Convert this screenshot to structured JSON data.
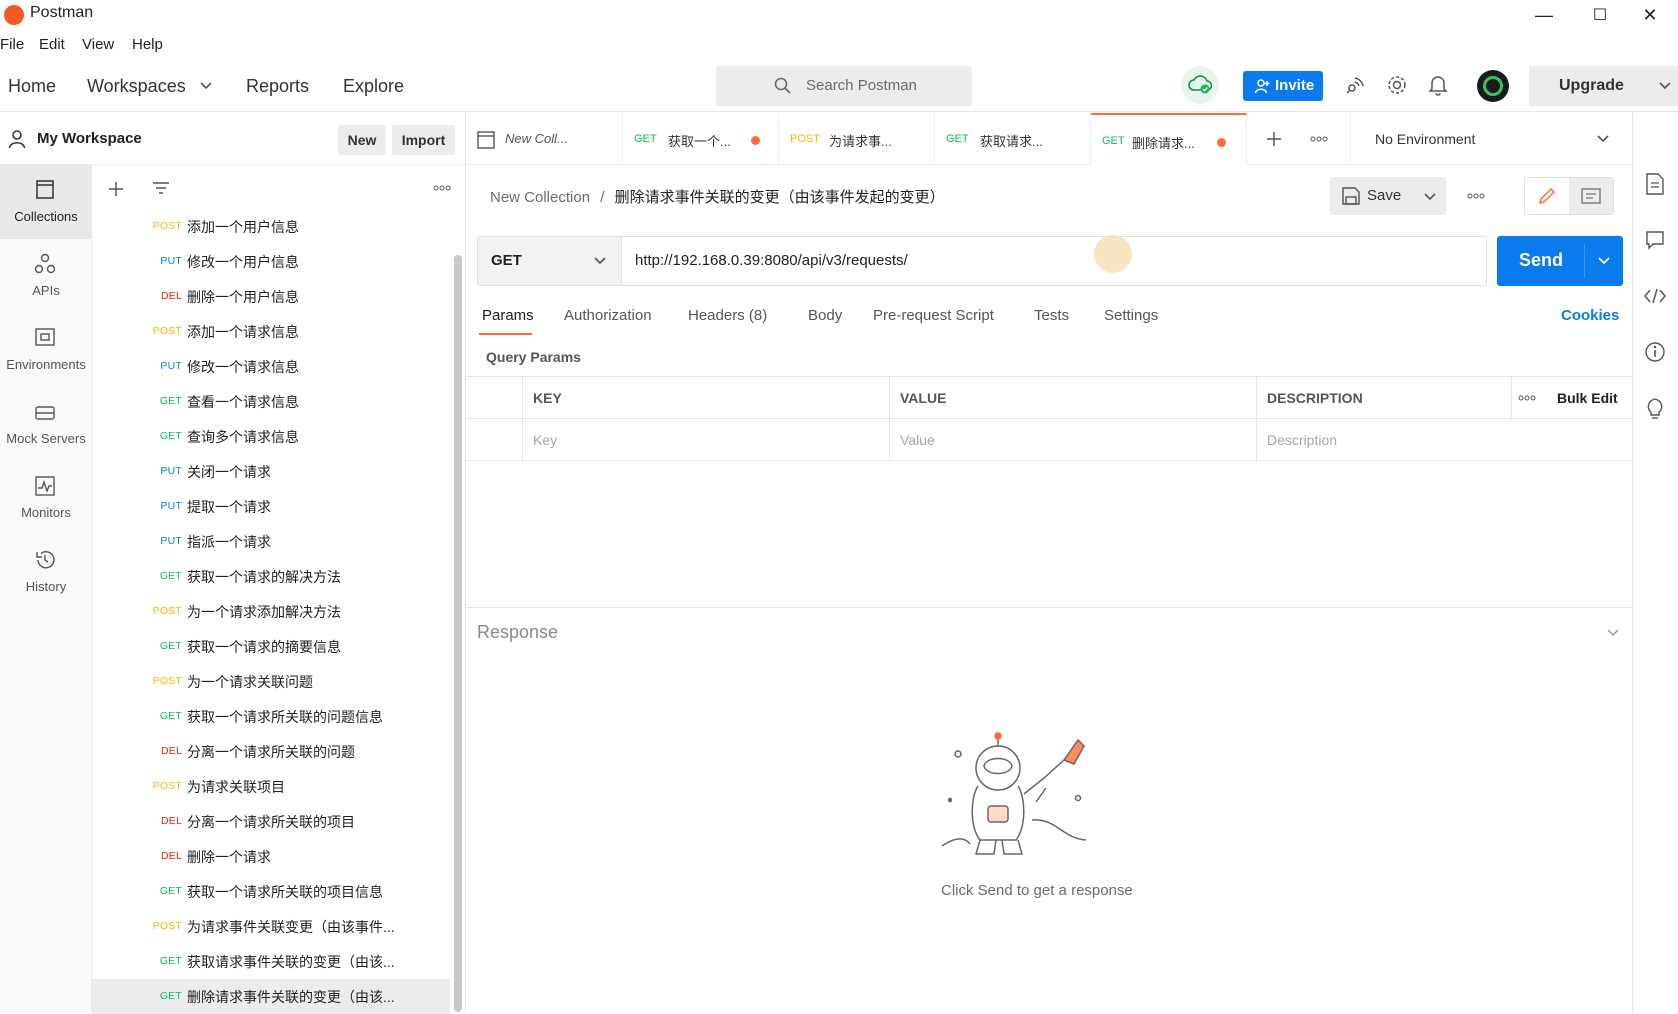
{
  "window": {
    "title": "Postman",
    "min": "—",
    "max": "☐",
    "close": "✕"
  },
  "menu": [
    "File",
    "Edit",
    "View",
    "Help"
  ],
  "nav": {
    "home": "Home",
    "workspaces": "Workspaces",
    "reports": "Reports",
    "explore": "Explore"
  },
  "search": {
    "placeholder": "Search Postman"
  },
  "invite": "Invite",
  "upgrade": "Upgrade",
  "workspace": {
    "name": "My Workspace",
    "new": "New",
    "import": "Import"
  },
  "leftnav": [
    "Collections",
    "APIs",
    "Environments",
    "Mock Servers",
    "Monitors",
    "History"
  ],
  "requests": [
    {
      "method": "POST",
      "name": "添加一个用户信息"
    },
    {
      "method": "PUT",
      "name": "修改一个用户信息"
    },
    {
      "method": "DEL",
      "name": "删除一个用户信息"
    },
    {
      "method": "POST",
      "name": "添加一个请求信息"
    },
    {
      "method": "PUT",
      "name": "修改一个请求信息"
    },
    {
      "method": "GET",
      "name": "查看一个请求信息"
    },
    {
      "method": "GET",
      "name": "查询多个请求信息"
    },
    {
      "method": "PUT",
      "name": "关闭一个请求"
    },
    {
      "method": "PUT",
      "name": "提取一个请求"
    },
    {
      "method": "PUT",
      "name": "指派一个请求"
    },
    {
      "method": "GET",
      "name": "获取一个请求的解决方法"
    },
    {
      "method": "POST",
      "name": "为一个请求添加解决方法"
    },
    {
      "method": "GET",
      "name": "获取一个请求的摘要信息"
    },
    {
      "method": "POST",
      "name": "为一个请求关联问题"
    },
    {
      "method": "GET",
      "name": "获取一个请求所关联的问题信息"
    },
    {
      "method": "DEL",
      "name": "分离一个请求所关联的问题"
    },
    {
      "method": "POST",
      "name": "为请求关联项目"
    },
    {
      "method": "DEL",
      "name": "分离一个请求所关联的项目"
    },
    {
      "method": "DEL",
      "name": "删除一个请求"
    },
    {
      "method": "GET",
      "name": "获取一个请求所关联的项目信息"
    },
    {
      "method": "POST",
      "name": "为请求事件关联变更（由该事件..."
    },
    {
      "method": "GET",
      "name": "获取请求事件关联的变更（由该..."
    },
    {
      "method": "GET",
      "name": "删除请求事件关联的变更（由该..."
    }
  ],
  "tabs": [
    {
      "method": "",
      "title": "New Coll..."
    },
    {
      "method": "GET",
      "title": "获取一个..."
    },
    {
      "method": "POST",
      "title": "为请求事..."
    },
    {
      "method": "GET",
      "title": "获取请求..."
    },
    {
      "method": "GET",
      "title": "删除请求..."
    }
  ],
  "environment": "No Environment",
  "breadcrumb": {
    "collection": "New Collection",
    "sep": "/",
    "request": "删除请求事件关联的变更（由该事件发起的变更）"
  },
  "save": "Save",
  "request": {
    "method": "GET",
    "url": "http://192.168.0.39:8080/api/v3/requests/"
  },
  "send": "Send",
  "reqtabs": [
    "Params",
    "Authorization",
    "Headers (8)",
    "Body",
    "Pre-request Script",
    "Tests",
    "Settings"
  ],
  "cookies": "Cookies",
  "query_params": {
    "title": "Query Params",
    "headers": [
      "KEY",
      "VALUE",
      "DESCRIPTION"
    ],
    "bulk_edit": "Bulk Edit",
    "placeholders": [
      "Key",
      "Value",
      "Description"
    ]
  },
  "response": {
    "title": "Response",
    "hint": "Click Send to get a response"
  },
  "colors": {
    "accent": "#ff6c37",
    "blue": "#097bed",
    "get": "#0cbb52",
    "post": "#ffb400",
    "put": "#097bed",
    "del": "#eb2013"
  }
}
